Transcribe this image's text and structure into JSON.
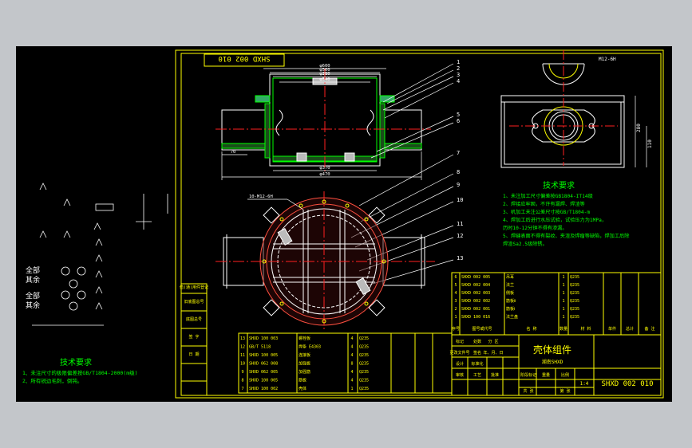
{
  "drawing": {
    "code_topleft": "SHXD 002 010",
    "code_bottom": "SHXD 002 010",
    "title": "壳体组件",
    "subtitle": "湖南SHXD",
    "scale": "1:4",
    "weight": "",
    "sheet": ""
  },
  "tech_req_left": {
    "heading": "技术要求",
    "lines": [
      "1、未注尺寸的极限偏差按GB/T1804-2000(m级)",
      "2、所有锐边毛刺，倒钝。"
    ]
  },
  "tech_req_right": {
    "heading": "技术要求",
    "lines": [
      "1、未注加工尺寸偏差按GB1804-IT14级",
      "2、焊接应牢固，不许有漏焊、焊渣等",
      "3、机加工未注公差尺寸按GB/T1804-m",
      "4、焊加工后进行水压试验，试验压力为1MPa，",
      "   历时10-12分钟不得有渗漏。",
      "5、焊缝表面不得有裂纹、夹渣及焊瘤等缺陷，焊加工后除",
      "   焊渣Sa2.5级除锈。"
    ]
  },
  "symbols_left": {
    "labels": [
      "全部",
      "其余",
      "全部",
      "其余"
    ]
  },
  "dimensions": {
    "top_view": [
      "φ600",
      "φ560",
      "φ380",
      "φ340",
      "φ370",
      "φ470",
      "70"
    ],
    "right_view": [
      "M12-6H",
      "280",
      "110"
    ],
    "circle_view": [
      "10-M12-6H"
    ]
  },
  "balloons": [
    "1",
    "2",
    "3",
    "4",
    "5",
    "6",
    "7",
    "8",
    "9",
    "10",
    "11",
    "12",
    "13"
  ],
  "bom_upper": {
    "rows": [
      [
        "6",
        "SHXD 002 005",
        "吊耳",
        "1",
        "Q235",
        "",
        ""
      ],
      [
        "5",
        "SHXD 002 004",
        "法兰",
        "1",
        "Q235",
        "",
        ""
      ],
      [
        "4",
        "SHXD 002 003",
        "侧板",
        "1",
        "Q235",
        "",
        ""
      ],
      [
        "3",
        "SHXD 002 002",
        "筋板Ⅱ",
        "1",
        "Q235",
        "",
        ""
      ],
      [
        "2",
        "SHXD 002 001",
        "筋板Ⅰ",
        "1",
        "Q235",
        "",
        ""
      ],
      [
        "1",
        "SHXD 100 016",
        "法兰盘",
        "1",
        "Q235",
        "",
        ""
      ]
    ],
    "header": [
      "序号",
      "图号或代号",
      "名 称",
      "数量",
      "材 料",
      "单件",
      "总计",
      "备 注"
    ]
  },
  "bom_lower": {
    "rows": [
      [
        "13",
        "SHXD 100 003",
        "螺栓板",
        "4",
        "Q235"
      ],
      [
        "12",
        "GB/T 5118",
        "焊条 E4303",
        "4",
        "Q235"
      ],
      [
        "11",
        "SHXD 100 005",
        "连接板",
        "4",
        "Q235"
      ],
      [
        "10",
        "SHXD 062 008",
        "加强板",
        "8",
        "Q235"
      ],
      [
        "9",
        "SHXD 062 005",
        "加强筋",
        "4",
        "Q235"
      ],
      [
        "8",
        "SHXD 100 005",
        "筋板",
        "4",
        "Q235"
      ],
      [
        "7",
        "SHXD 100 002",
        "壳体",
        "1",
        "Q235"
      ]
    ]
  },
  "left_strip": [
    "借(通)用件登记",
    "旧底图总号",
    "底图总号",
    "签 字",
    "日 期"
  ],
  "title_block_labels": [
    "标记",
    "处数",
    "分 区",
    "更改文件号",
    "签名",
    "年、月、日",
    "设计",
    "标准化",
    "阶段标记",
    "重量",
    "比例",
    "审核",
    "工艺",
    "批准",
    "共 张",
    "第 张"
  ]
}
